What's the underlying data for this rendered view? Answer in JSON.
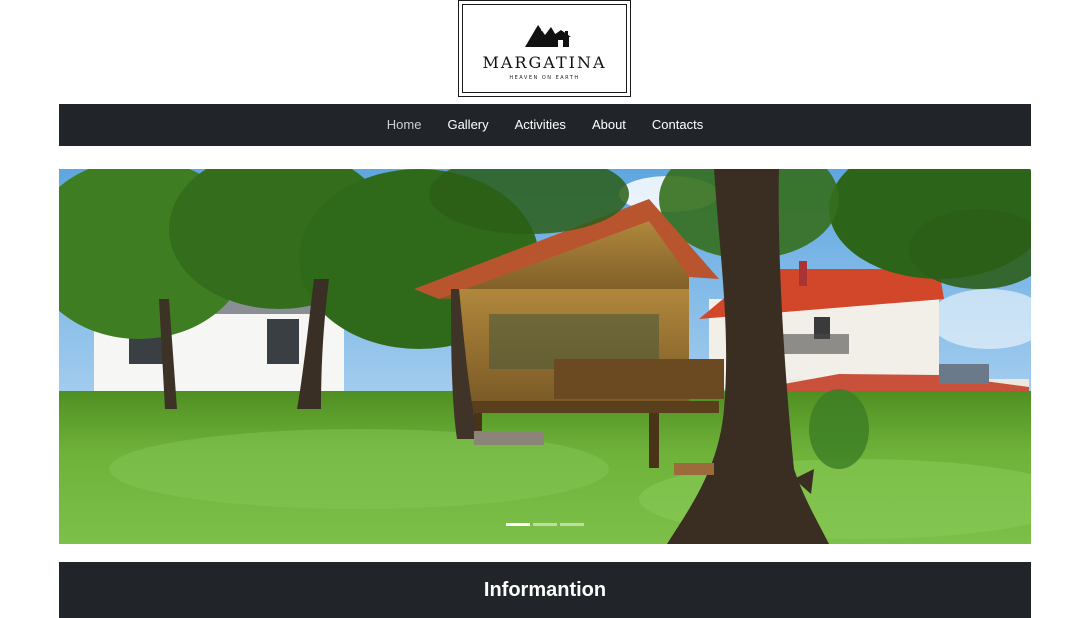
{
  "logo": {
    "name": "MARGATINA",
    "tagline": "HEAVEN ON EARTH",
    "icon": "mountain-house-icon"
  },
  "nav": {
    "items": [
      {
        "label": "Home",
        "active": true
      },
      {
        "label": "Gallery"
      },
      {
        "label": "Activities"
      },
      {
        "label": "About"
      },
      {
        "label": "Contacts"
      }
    ]
  },
  "carousel": {
    "slide_count": 3,
    "active_index": 0
  },
  "info": {
    "title": "Informantion"
  },
  "colors": {
    "nav_bg": "#212529",
    "accent_roof": "#d2472a",
    "grass": "#6fb23a"
  }
}
